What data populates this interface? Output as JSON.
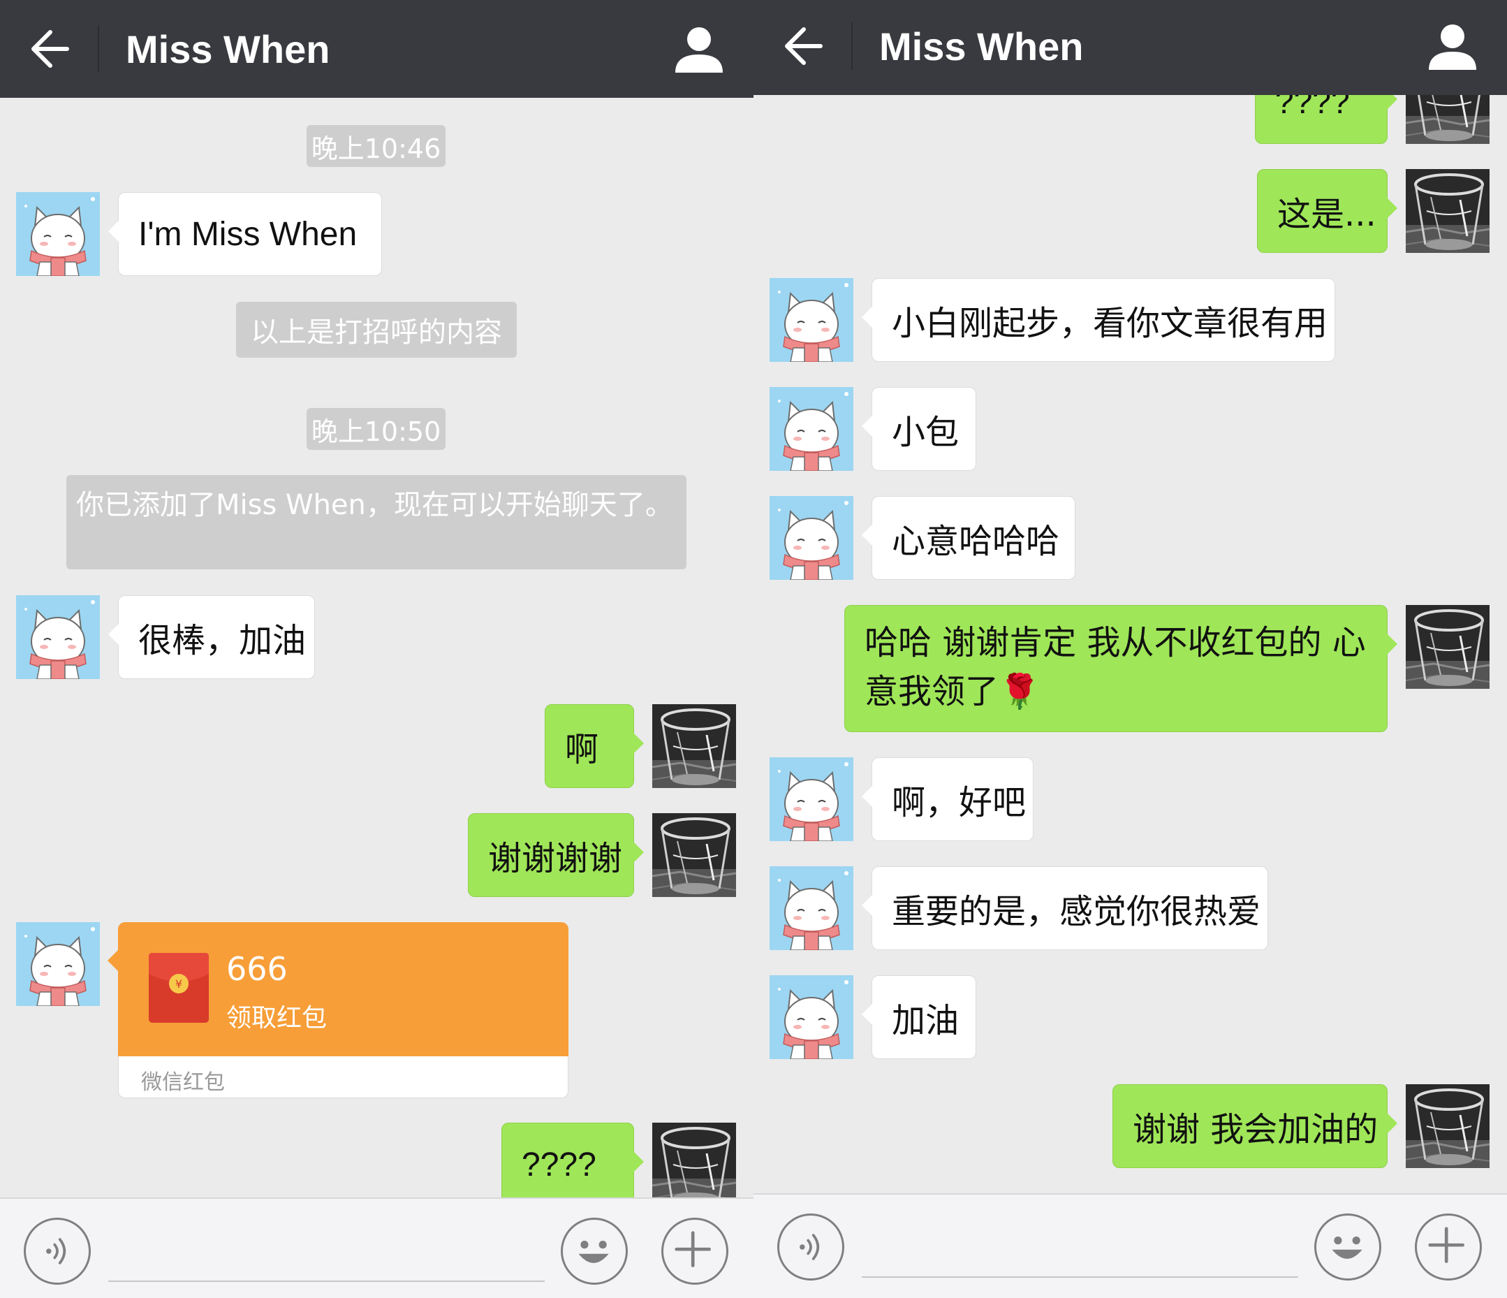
{
  "colors": {
    "topbar": "#393a3f",
    "chat_bg": "#ebebeb",
    "bubble_out": "#9fe658",
    "bubble_in": "#ffffff",
    "hongbao": "#f79e38",
    "system_pill": "#cecece"
  },
  "left": {
    "header": {
      "title": "Miss When",
      "back_icon": "arrow-left-icon",
      "contact_icon": "person-icon"
    },
    "messages": {
      "time1": "晚上10:46",
      "greeting": "I'm Miss When",
      "greeting_note": "以上是打招呼的内容",
      "time2": "晚上10:50",
      "added_notice": "你已添加了Miss When，现在可以开始聊天了。",
      "m1": "很棒，加油",
      "m2": "啊",
      "m3": "谢谢谢谢",
      "hongbao": {
        "amount": "666",
        "action": "领取红包",
        "brand": "微信红包"
      },
      "m4": "????"
    },
    "inputbar": {
      "voice_icon": "voice-icon",
      "emoji_icon": "emoji-icon",
      "plus_icon": "plus-icon"
    }
  },
  "right": {
    "header": {
      "title": "Miss When",
      "back_icon": "arrow-left-icon",
      "contact_icon": "person-icon"
    },
    "messages": {
      "r0": "????",
      "r1": "这是...",
      "r2": "小白刚起步，看你文章很有用",
      "r3": "小包",
      "r4": "心意哈哈哈",
      "r5": "哈哈 谢谢肯定 我从不收红包的 心意我领了🌹",
      "r6": "啊，好吧",
      "r7": "重要的是，感觉你很热爱",
      "r8": "加油",
      "r9": "谢谢 我会加油的"
    },
    "inputbar": {
      "voice_icon": "voice-icon",
      "emoji_icon": "emoji-icon",
      "plus_icon": "plus-icon"
    }
  }
}
